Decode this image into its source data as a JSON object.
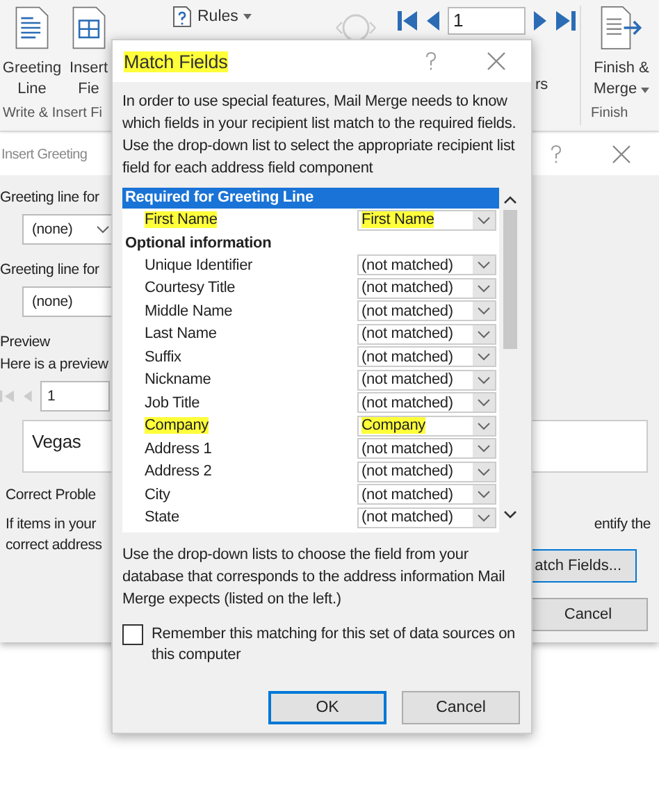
{
  "ribbon": {
    "greeting_line": [
      "Greeting",
      "Line"
    ],
    "insert_fields": [
      "Insert",
      "Fie"
    ],
    "rules": "Rules",
    "record": "1",
    "partial_label": "rs",
    "finish_merge": [
      "Finish &",
      "Merge"
    ],
    "group_labels": [
      "Write & Insert Fi",
      "Finish"
    ]
  },
  "greeting_dialog": {
    "title": "Insert Greeting",
    "format_label": "Greeting line for",
    "format_value": "(none)",
    "invalid_label": "Greeting line for",
    "invalid_value": "(none)",
    "preview_label": "Preview",
    "preview_intro": "Here is a preview",
    "record": "1",
    "preview_text": "Vegas",
    "correct_label": "Correct Proble",
    "correct_text_left": [
      "If items in your",
      "correct address"
    ],
    "correct_text_right": "entify the",
    "match_button": "atch Fields...",
    "cancel_button": "Cancel"
  },
  "match_dialog": {
    "title": "Match Fields",
    "title_highlighted": true,
    "intro": "In order to use special features, Mail Merge needs to know which fields in your recipient list match to the required fields.  Use the drop-down list to select the appropriate recipient list field for each address field component",
    "required_header": "Required for Greeting Line",
    "required": [
      {
        "field": "First Name",
        "match": "First Name",
        "highlighted": true
      }
    ],
    "optional_header": "Optional information",
    "optional": [
      {
        "field": "Unique Identifier",
        "match": "(not matched)",
        "highlighted": false
      },
      {
        "field": "Courtesy Title",
        "match": "(not matched)",
        "highlighted": false
      },
      {
        "field": "Middle Name",
        "match": "(not matched)",
        "highlighted": false
      },
      {
        "field": "Last Name",
        "match": "(not matched)",
        "highlighted": false
      },
      {
        "field": "Suffix",
        "match": "(not matched)",
        "highlighted": false
      },
      {
        "field": "Nickname",
        "match": "(not matched)",
        "highlighted": false
      },
      {
        "field": "Job Title",
        "match": "(not matched)",
        "highlighted": false
      },
      {
        "field": "Company",
        "match": "Company",
        "highlighted": true
      },
      {
        "field": "Address 1",
        "match": "(not matched)",
        "highlighted": false
      },
      {
        "field": "Address 2",
        "match": "(not matched)",
        "highlighted": false
      },
      {
        "field": "City",
        "match": "(not matched)",
        "highlighted": false
      },
      {
        "field": "State",
        "match": "(not matched)",
        "highlighted": false
      }
    ],
    "footer_text": "Use the drop-down lists to choose the field from your database that corresponds to the address information Mail Merge expects (listed on the left.)",
    "remember": {
      "label": "Remember this matching for this set of data sources on this computer",
      "checked": false
    },
    "buttons": [
      {
        "label": "OK",
        "default": true
      },
      {
        "label": "Cancel",
        "default": false
      }
    ]
  }
}
